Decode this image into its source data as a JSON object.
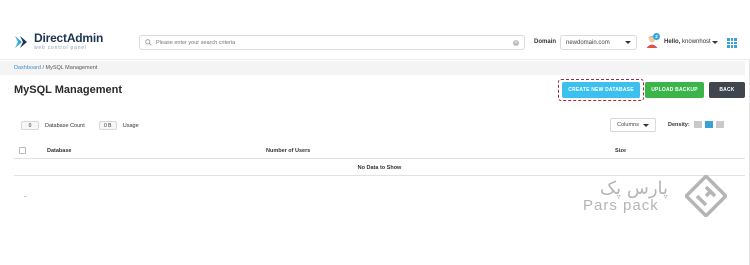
{
  "brand": {
    "title": "DirectAdmin",
    "subtitle": "web control panel",
    "accent": "#30a7e0"
  },
  "search": {
    "placeholder": "Please enter your search criteria"
  },
  "domain": {
    "label": "Domain",
    "value": "newdomain.com"
  },
  "user": {
    "greeting": "Hello,",
    "name": "knownhost",
    "badge": "2"
  },
  "breadcrumb": {
    "home": "Dashboard",
    "separator": "/",
    "current": "MySQL Management"
  },
  "page": {
    "title": "MySQL Management"
  },
  "buttons": {
    "create": "CREATE NEW DATABASE",
    "upload": "UPLOAD BACKUP",
    "back": "BACK"
  },
  "stats": {
    "db_count_value": "0",
    "db_count_label": "Database Count",
    "usage_value": "0 B",
    "usage_label": "Usage"
  },
  "toolbar": {
    "columns": "Columns",
    "density": "Density:"
  },
  "table": {
    "columns": [
      "Database",
      "Number of Users",
      "Size"
    ],
    "empty": "No Data to Show"
  },
  "watermark": {
    "fa": "پارس پک",
    "en": "Pars pack"
  }
}
